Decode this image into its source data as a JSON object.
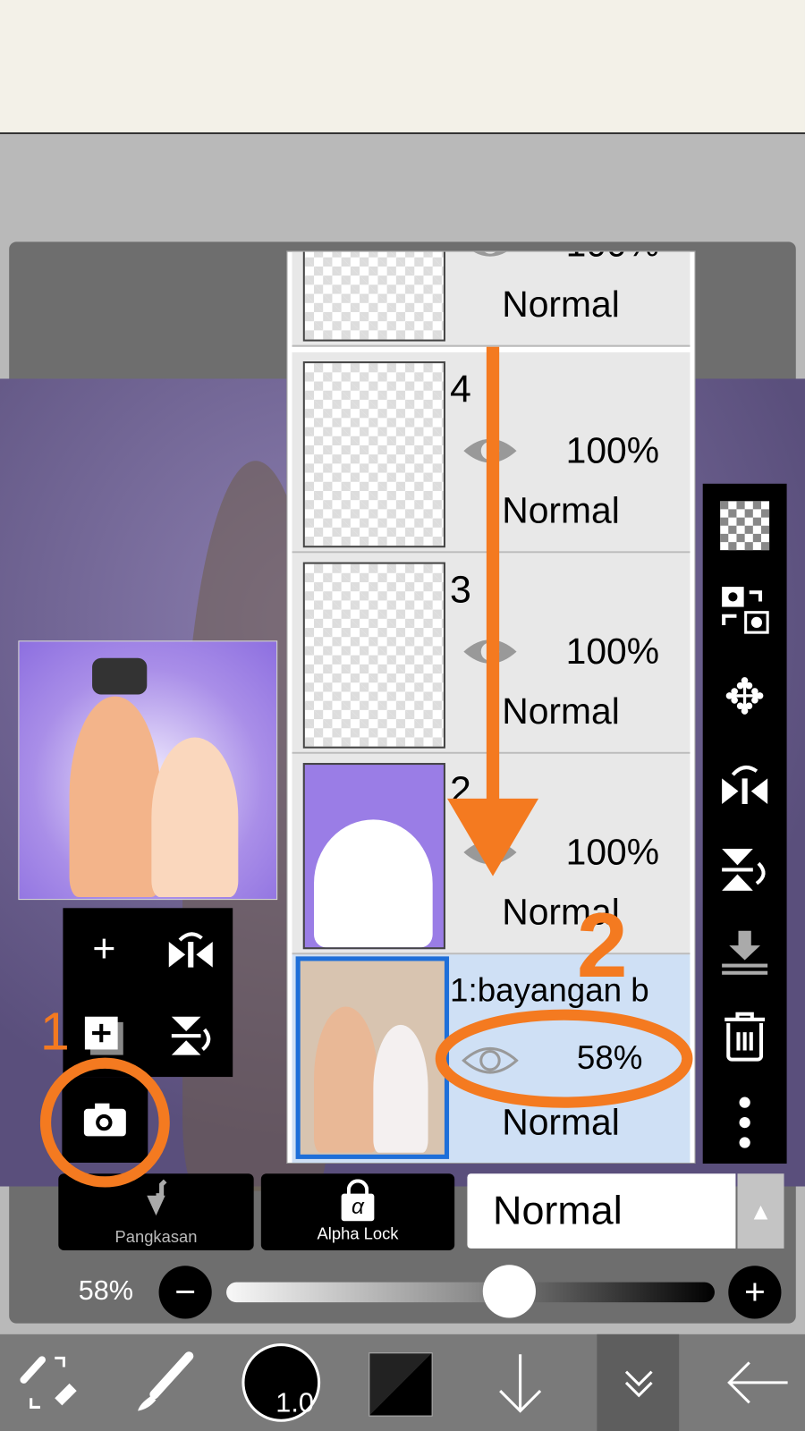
{
  "layers": [
    {
      "name": "",
      "opacity": "100%",
      "mode": "Normal"
    },
    {
      "name": "4",
      "opacity": "100%",
      "mode": "Normal"
    },
    {
      "name": "3",
      "opacity": "100%",
      "mode": "Normal"
    },
    {
      "name": "2",
      "opacity": "100%",
      "mode": "Normal"
    },
    {
      "name": "1:bayangan b",
      "opacity": "58%",
      "mode": "Normal",
      "selected": true
    }
  ],
  "panel": {
    "clipping_label": "Pangkasan",
    "alpha_lock_label": "Alpha Lock",
    "alpha_symbol": "α",
    "blend_mode": "Normal",
    "opacity_label": "58%",
    "opacity_value": 0.58
  },
  "bottom": {
    "brush_size": "1.0"
  },
  "annotations": {
    "marker_1": "1",
    "marker_2": "2",
    "color": "#f47a20"
  },
  "colors": {
    "selected_layer": "#cfe0f5",
    "selected_border": "#1e6fd9"
  }
}
